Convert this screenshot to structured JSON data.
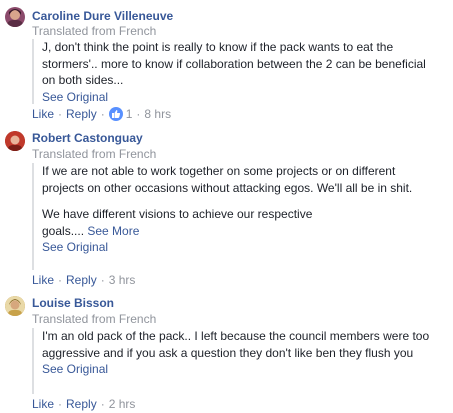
{
  "comments": [
    {
      "author": "Caroline Dure Villeneuve",
      "translated_label": "Translated from French",
      "text": "J, don't think the point is really to know if the pack wants to eat the stormers'.. more to know if collaboration between the 2 can be beneficial on both sides...",
      "see_original": "See Original",
      "like": "Like",
      "reply": "Reply",
      "reaction_count": "1",
      "time": "8 hrs",
      "avatar_color": "#8b4a6b"
    },
    {
      "author": "Robert Castonguay",
      "translated_label": "Translated from French",
      "text": "If we are not able to work together on some projects or on different projects on other occasions without attacking egos. We'll all be in shit.",
      "text2": "We have different visions to achieve our respective goals....",
      "see_more": "See More",
      "see_original": "See Original",
      "like": "Like",
      "reply": "Reply",
      "time": "3 hrs",
      "avatar_color": "#b03a2e"
    },
    {
      "author": "Louise Bisson",
      "translated_label": "Translated from French",
      "text": "I'm an old pack of the pack.. I left because the council members were too aggressive and if you ask a question they don't like ben they flush you",
      "see_original": "See Original",
      "like": "Like",
      "reply": "Reply",
      "time": "2 hrs",
      "avatar_color": "#c8a24a"
    }
  ],
  "icons": {
    "like_reaction": "thumbs-up-icon"
  },
  "colors": {
    "link": "#385898",
    "meta": "#90949c",
    "like_badge": "#5890ff"
  }
}
